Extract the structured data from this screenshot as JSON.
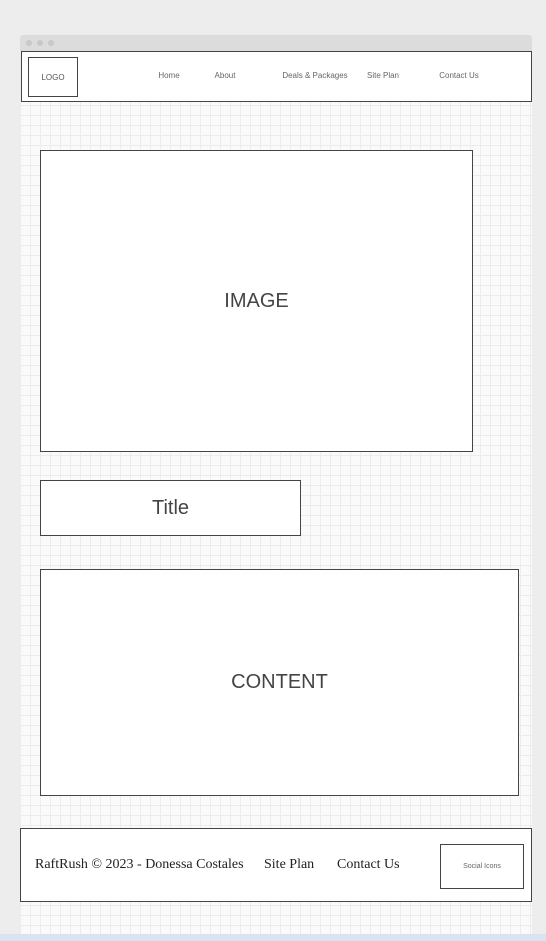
{
  "header": {
    "logo": "LOGO",
    "nav": [
      "Home",
      "About",
      "Deals & Packages",
      "Site Plan",
      "Contact Us"
    ]
  },
  "main": {
    "image": "IMAGE",
    "title": "Title",
    "content": "CONTENT"
  },
  "footer": {
    "copyright": "RaftRush © 2023 - Donessa Costales",
    "links": [
      "Site Plan",
      "Contact Us"
    ],
    "social": "Social Icons"
  }
}
